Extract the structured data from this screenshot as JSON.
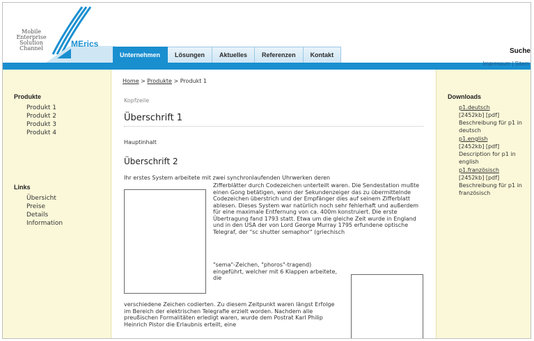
{
  "brand": {
    "tagline_lines": [
      "Mobile",
      "Enterprise",
      "Solution",
      "Channel"
    ],
    "wordmark": "MErics",
    "accent_color": "#1a8fd0"
  },
  "nav": {
    "tabs": [
      {
        "label": "Unternehmen",
        "active": true
      },
      {
        "label": "Lösungen",
        "active": false
      },
      {
        "label": "Aktuelles",
        "active": false
      },
      {
        "label": "Referenzen",
        "active": false
      },
      {
        "label": "Kontakt",
        "active": false
      }
    ],
    "search_label": "Suche",
    "meta_links": "Impressum | Sitem"
  },
  "left": {
    "products_heading": "Produkte",
    "products": [
      "Produkt 1",
      "Produkt 2",
      "Produkt 3",
      "Produkt 4"
    ],
    "links_heading": "Links",
    "links": [
      "Übersicht",
      "Preise",
      "Details",
      "Information"
    ]
  },
  "main": {
    "breadcrumb": {
      "home": "Home",
      "sep1": " > ",
      "products": "Produkte",
      "sep2": " > ",
      "current": "Produkt 1"
    },
    "kopfzeile": "Kopfzeile",
    "heading1": "Überschrift 1",
    "hauptinhalt": "Hauptinhalt",
    "heading2": "Überschrift 2",
    "para_first_line": "Ihr erstes System arbeitete mit zwei synchronlaufenden Uhrwerken deren",
    "para_indent": "Zifferblätter durch Codezeichen unterteilt waren. Die Sendestation mußte einen Gong betätigen, wenn der Sekundenzeiger das zu übermittelnde Codezeichen überstrich und der Empfänger dies auf seinem Zifferblatt ablesen. Dieses System war natürlich noch sehr fehlerhaft und außerdem für eine maximale Entfernung von ca. 400m konstruiert. Die erste Übertragung fand 1793 statt. Etwa um die gleiche Zeit wurde in England und in den USA der von Lord George Murray 1795 erfundene optische Telegraf, der \"sc shutter semaphor\" (griechisch",
    "para_narrow": "\"sema\"-Zeichen, \"phoros\"-tragend) eingeführt, welcher mit 6 Klappen arbeitete, die",
    "para_bottom": "verschiedene Zeichen codierten. Zu diesem Zeitpunkt waren längst Erfolge im Bereich der elektrischen Telegrafie erzielt worden. Nachdem alle preußischen Formalitäten erledigt waren, wurde dem Postrat Karl Philip Heinrich Pistor die Erlaubnis erteilt, eine"
  },
  "right": {
    "downloads_heading": "Downloads",
    "items": [
      {
        "link": "p1.deutsch",
        "size": "[2452kb] [pdf]",
        "desc": "Beschreibung für p1 in deutsch"
      },
      {
        "link": "p1.english",
        "size": "[2452kb] [pdf]",
        "desc": "Description for p1 in english"
      },
      {
        "link": "p1.französisch",
        "size": "[2452kb] [pdf]",
        "desc": "Beschreibung für p1 in französisch"
      }
    ]
  }
}
